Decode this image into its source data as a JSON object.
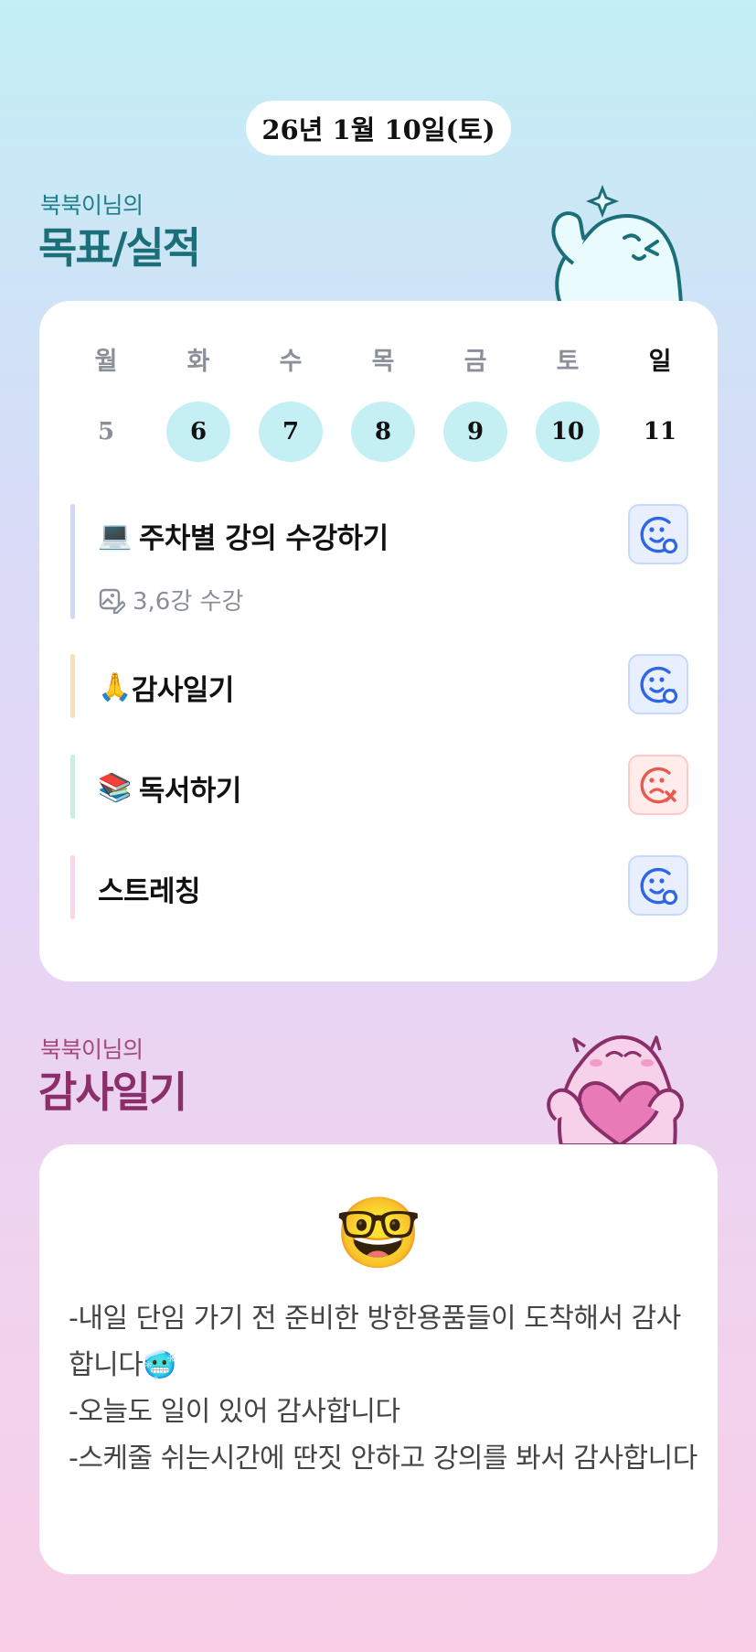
{
  "date_label": "26년 1월 10일(토)",
  "goals_section": {
    "subtitle": "북북이님의",
    "title": "목표/실적"
  },
  "calendar": {
    "weekdays": [
      "월",
      "화",
      "수",
      "목",
      "금",
      "토",
      "일"
    ],
    "days": [
      "5",
      "6",
      "7",
      "8",
      "9",
      "10",
      "11"
    ],
    "completed_days": [
      "6",
      "7",
      "8",
      "9",
      "10"
    ]
  },
  "habits": [
    {
      "emoji": "💻",
      "label": "주차별 강의 수강하기",
      "note": "3,6강 수강",
      "status": "success",
      "bar_color": "#cfd9fb"
    },
    {
      "emoji": "🙏",
      "label": "감사일기",
      "note": "",
      "status": "success",
      "bar_color": "#ffdcb8"
    },
    {
      "emoji": "📚",
      "label": "독서하기",
      "note": "",
      "status": "fail",
      "bar_color": "#c4f1e2"
    },
    {
      "emoji": "",
      "label": "스트레칭",
      "note": "",
      "status": "success",
      "bar_color": "#fcd3ea"
    }
  ],
  "gratitude_section": {
    "subtitle": "북북이님의",
    "title": "감사일기"
  },
  "gratitude": {
    "mood_emoji": "🤓",
    "lines": [
      "-내일 단임 가기 전 준비한 방한용품들이 도착해서 감사합니다🥶",
      "-오늘도 일이 있어 감사합니다",
      "-스케줄 쉬는시간에 딴짓 안하고 강의를 봐서 감사합니다"
    ]
  },
  "colors": {
    "teal_title": "#1b6f78",
    "plum_title": "#8a2f6a",
    "success_icon": "#2f66e8",
    "fail_icon": "#e85a4f",
    "completed_day_bg": "#c4f0f4"
  },
  "icons": {
    "success": "smiley-success-icon",
    "fail": "frown-fail-icon",
    "note": "image-edit-icon"
  }
}
